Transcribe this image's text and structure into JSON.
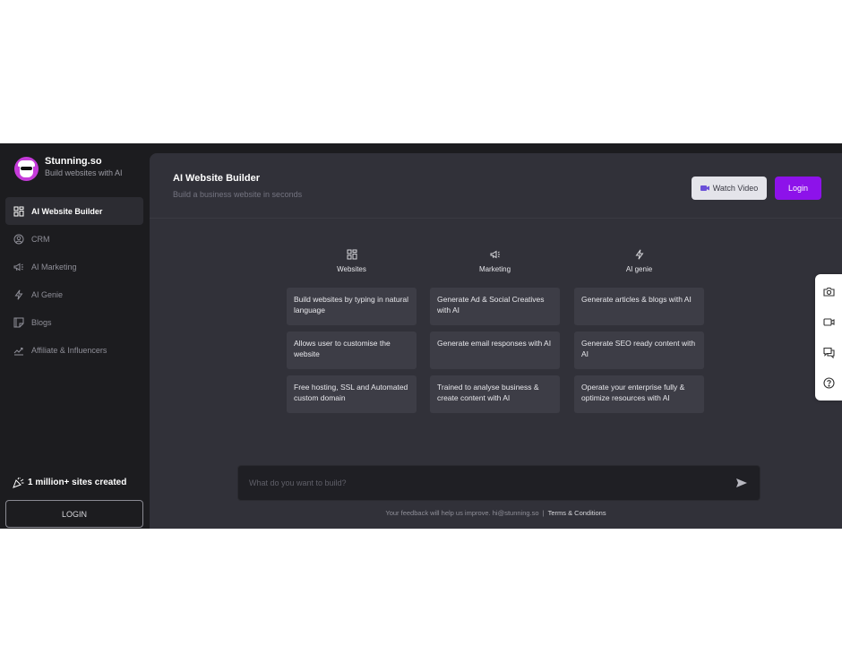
{
  "brand": {
    "name": "Stunning.so",
    "tagline": "Build websites with AI",
    "color": "#c53bd9"
  },
  "sidebar": {
    "items": [
      {
        "label": "AI Website Builder",
        "icon": "grid-icon",
        "active": true
      },
      {
        "label": "CRM",
        "icon": "user-circle-icon"
      },
      {
        "label": "AI Marketing",
        "icon": "megaphone-icon"
      },
      {
        "label": "AI Genie",
        "icon": "lightning-icon"
      },
      {
        "label": "Blogs",
        "icon": "document-icon"
      },
      {
        "label": "Affiliate & Influencers",
        "icon": "chart-icon"
      }
    ],
    "sites_created": "1 million+ sites created",
    "login_label": "LOGIN"
  },
  "header": {
    "title": "AI Website Builder",
    "subtitle": "Build a business website in seconds",
    "watch_label": "Watch Video",
    "login_label": "Login",
    "accent": "#8d12ea"
  },
  "columns": [
    {
      "title": "Websites",
      "icon": "grid-icon",
      "features": [
        "Build websites by typing in natural language",
        "Allows user to customise the website",
        "Free hosting, SSL and Automated custom domain"
      ]
    },
    {
      "title": "Marketing",
      "icon": "megaphone-icon",
      "features": [
        "Generate Ad & Social Creatives with AI",
        "Generate email responses with AI",
        "Trained to analyse business & create content with AI"
      ]
    },
    {
      "title": "AI genie",
      "icon": "lightning-icon",
      "features": [
        "Generate articles & blogs with AI",
        "Generate SEO ready content with AI",
        "Operate your enterprise fully & optimize resources with AI"
      ]
    }
  ],
  "prompt": {
    "placeholder": "What do you want to build?"
  },
  "footer": {
    "text": "Your feedback will help us improve. hi@stunning.so",
    "separator": "|",
    "terms": "Terms & Conditions"
  },
  "tools": [
    "camera-icon",
    "video-icon",
    "chat-icon",
    "help-icon"
  ]
}
